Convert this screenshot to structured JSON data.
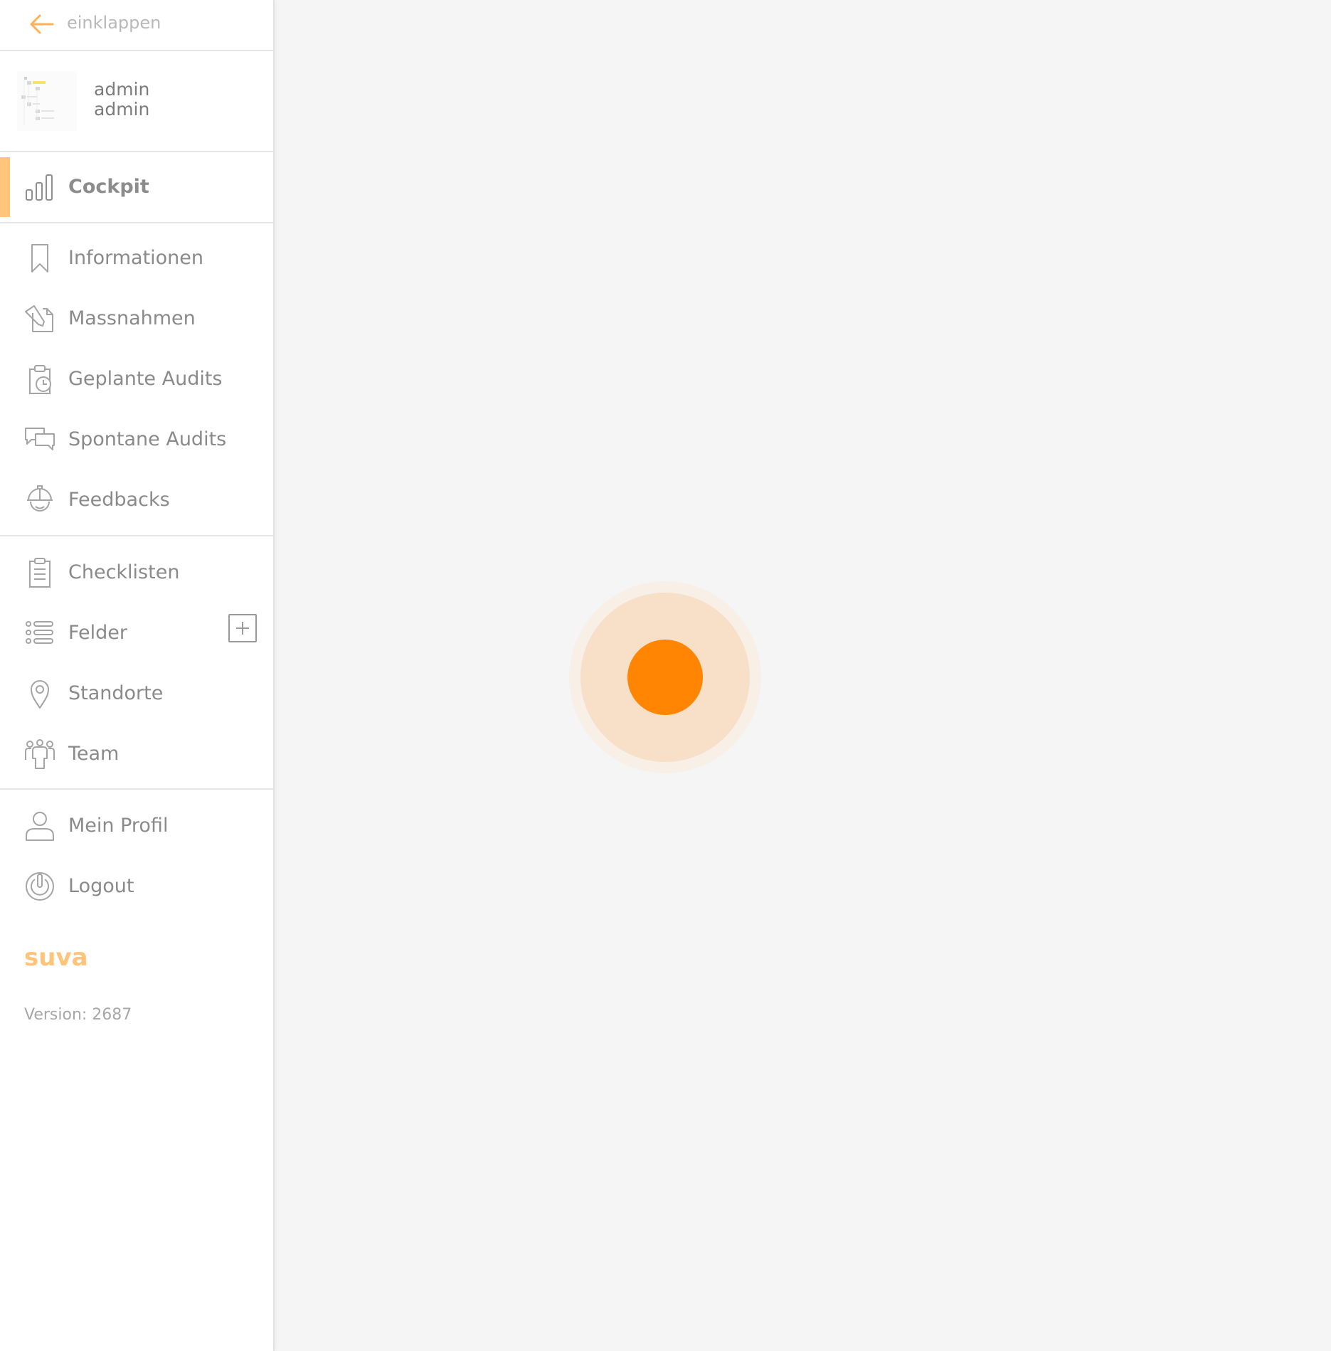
{
  "sidebar": {
    "collapse_label": "einklappen",
    "user": {
      "first_name": "admin",
      "last_name": "admin"
    },
    "items": [
      {
        "label": "Cockpit",
        "icon": "bar-chart-icon",
        "active": true
      },
      {
        "label": "Informationen",
        "icon": "bookmark-icon"
      },
      {
        "label": "Massnahmen",
        "icon": "document-pencil-icon"
      },
      {
        "label": "Geplante Audits",
        "icon": "clipboard-clock-icon"
      },
      {
        "label": "Spontane Audits",
        "icon": "chat-bubbles-icon"
      },
      {
        "label": "Feedbacks",
        "icon": "helmet-face-icon"
      },
      {
        "label": "Checklisten",
        "icon": "checklist-icon"
      },
      {
        "label": "Felder",
        "icon": "list-icon",
        "has_add_button": true
      },
      {
        "label": "Standorte",
        "icon": "map-pin-icon"
      },
      {
        "label": "Team",
        "icon": "team-icon"
      },
      {
        "label": "Mein Profil",
        "icon": "user-icon"
      },
      {
        "label": "Logout",
        "icon": "power-icon"
      }
    ],
    "logo_text": "suva",
    "version": "Version: 2687"
  },
  "colors": {
    "accent": "#ffc57a",
    "spinner_dot": "#ff8502",
    "spinner_ring": "#f8dfc8",
    "text": "#8a8a8a",
    "background": "#f5f5f5"
  },
  "main": {
    "loading_indicator": "spinner"
  }
}
